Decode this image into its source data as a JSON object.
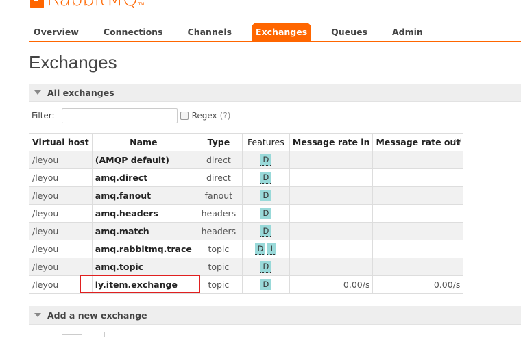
{
  "app": {
    "logo_text": "RabbitMQ",
    "logo_tm": "TM",
    "brand_color": "#ff6600"
  },
  "nav": {
    "tabs": [
      {
        "label": "Overview",
        "active": false
      },
      {
        "label": "Connections",
        "active": false
      },
      {
        "label": "Channels",
        "active": false
      },
      {
        "label": "Exchanges",
        "active": true
      },
      {
        "label": "Queues",
        "active": false
      },
      {
        "label": "Admin",
        "active": false
      }
    ]
  },
  "page": {
    "title": "Exchanges"
  },
  "all_exchanges": {
    "section_label": "All exchanges",
    "filter_label": "Filter:",
    "filter_value": "",
    "regex_label": "Regex",
    "regex_help": "(?)",
    "regex_checked": false,
    "columns_toggle": "+/-",
    "columns": [
      "Virtual host",
      "Name",
      "Type",
      "Features",
      "Message rate in",
      "Message rate out"
    ],
    "rows": [
      {
        "vhost": "/leyou",
        "name": "(AMQP default)",
        "type": "direct",
        "features": [
          "D"
        ],
        "rate_in": "",
        "rate_out": ""
      },
      {
        "vhost": "/leyou",
        "name": "amq.direct",
        "type": "direct",
        "features": [
          "D"
        ],
        "rate_in": "",
        "rate_out": ""
      },
      {
        "vhost": "/leyou",
        "name": "amq.fanout",
        "type": "fanout",
        "features": [
          "D"
        ],
        "rate_in": "",
        "rate_out": ""
      },
      {
        "vhost": "/leyou",
        "name": "amq.headers",
        "type": "headers",
        "features": [
          "D"
        ],
        "rate_in": "",
        "rate_out": ""
      },
      {
        "vhost": "/leyou",
        "name": "amq.match",
        "type": "headers",
        "features": [
          "D"
        ],
        "rate_in": "",
        "rate_out": ""
      },
      {
        "vhost": "/leyou",
        "name": "amq.rabbitmq.trace",
        "type": "topic",
        "features": [
          "D",
          "I"
        ],
        "rate_in": "",
        "rate_out": ""
      },
      {
        "vhost": "/leyou",
        "name": "amq.topic",
        "type": "topic",
        "features": [
          "D"
        ],
        "rate_in": "",
        "rate_out": ""
      },
      {
        "vhost": "/leyou",
        "name": "ly.item.exchange",
        "type": "topic",
        "features": [
          "D"
        ],
        "rate_in": "0.00/s",
        "rate_out": "0.00/s"
      }
    ],
    "highlight_color": "#e02020"
  },
  "add_exchange": {
    "section_label": "Add a new exchange"
  },
  "colors": {
    "feature_badge": "#99d9d9",
    "section_bg": "#eeeeee",
    "row_alt_bg": "#f1f1f1"
  }
}
